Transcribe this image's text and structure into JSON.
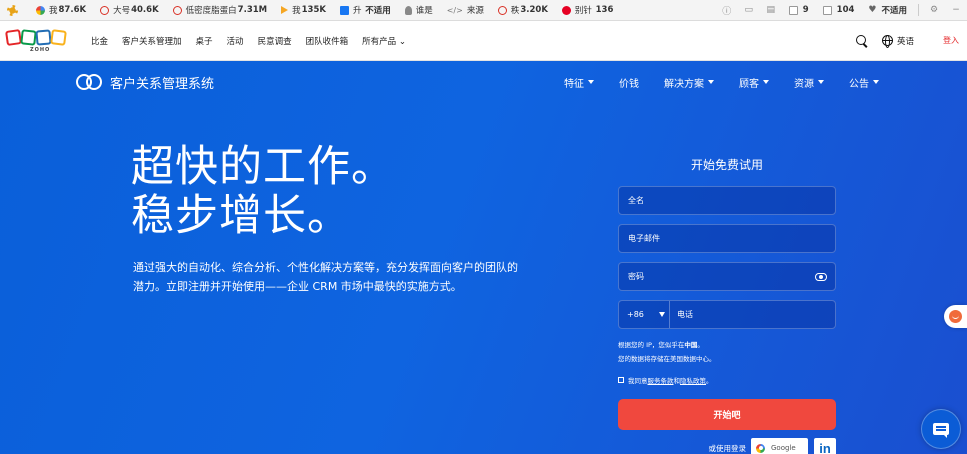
{
  "seo_toolbar": {
    "items": [
      {
        "icon": "seo-tool-icon",
        "label": "",
        "value": ""
      },
      {
        "icon": "google-icon",
        "label": "我",
        "value": "87.6K"
      },
      {
        "icon": "ring-icon",
        "label": "大号",
        "value": "40.6K"
      },
      {
        "icon": "ring-icon",
        "label": "低密度脂蛋白",
        "value": "7.31M"
      },
      {
        "icon": "play-icon",
        "label": "我",
        "value": "135K"
      },
      {
        "icon": "facebook-icon",
        "label": "升",
        "value": "不适用"
      },
      {
        "icon": "user-icon",
        "label": "谁是",
        "value": ""
      },
      {
        "icon": "code-icon",
        "label": "来源",
        "value": ""
      },
      {
        "icon": "ring-icon",
        "label": "秩",
        "value": "3.20K"
      },
      {
        "icon": "pinterest-icon",
        "label": "别针",
        "value": "136"
      }
    ],
    "right": {
      "count_a": "9",
      "count_b": "104",
      "heart_label": "不适用"
    }
  },
  "zoho_nav": {
    "logo_text": "ZOHO",
    "links": [
      "比金",
      "客户关系管理加",
      "桌子",
      "活动",
      "民意调查",
      "团队收件箱",
      "所有产品"
    ],
    "language": "英语",
    "signin": "登入"
  },
  "crm_header": {
    "brand": "客户关系管理系统",
    "menu": [
      "特征",
      "价钱",
      "解决方案",
      "顾客",
      "资源",
      "公告"
    ]
  },
  "hero": {
    "headline_line1": "超快的工作。",
    "headline_line2": "稳步增长。",
    "subtext": "通过强大的自动化、综合分析、个性化解决方案等，充分发挥面向客户的团队的潜力。立即注册并开始使用——企业 CRM 市场中最快的实施方式。"
  },
  "signup_form": {
    "title": "开始免费试用",
    "name_placeholder": "全名",
    "email_placeholder": "电子邮件",
    "password_placeholder": "密码",
    "country_code": "+86",
    "phone_placeholder": "电话",
    "ip_note_prefix": "根据您的 IP，您似乎在",
    "ip_country": "中国",
    "ip_note_suffix": "。",
    "data_note": "您的数据将存储在美国数据中心。",
    "agree_prefix": "我同意",
    "terms_link": "服务条款",
    "agree_and": "和",
    "privacy_link": "隐私政策",
    "agree_suffix": "。",
    "submit_label": "开始吧",
    "or_login": "或使用登录",
    "google_label": "Google",
    "linkedin_label": "in"
  },
  "colors": {
    "hero_bg": "#0a5fd9",
    "submit_red": "#f0483e",
    "signin_red": "#e42527"
  }
}
